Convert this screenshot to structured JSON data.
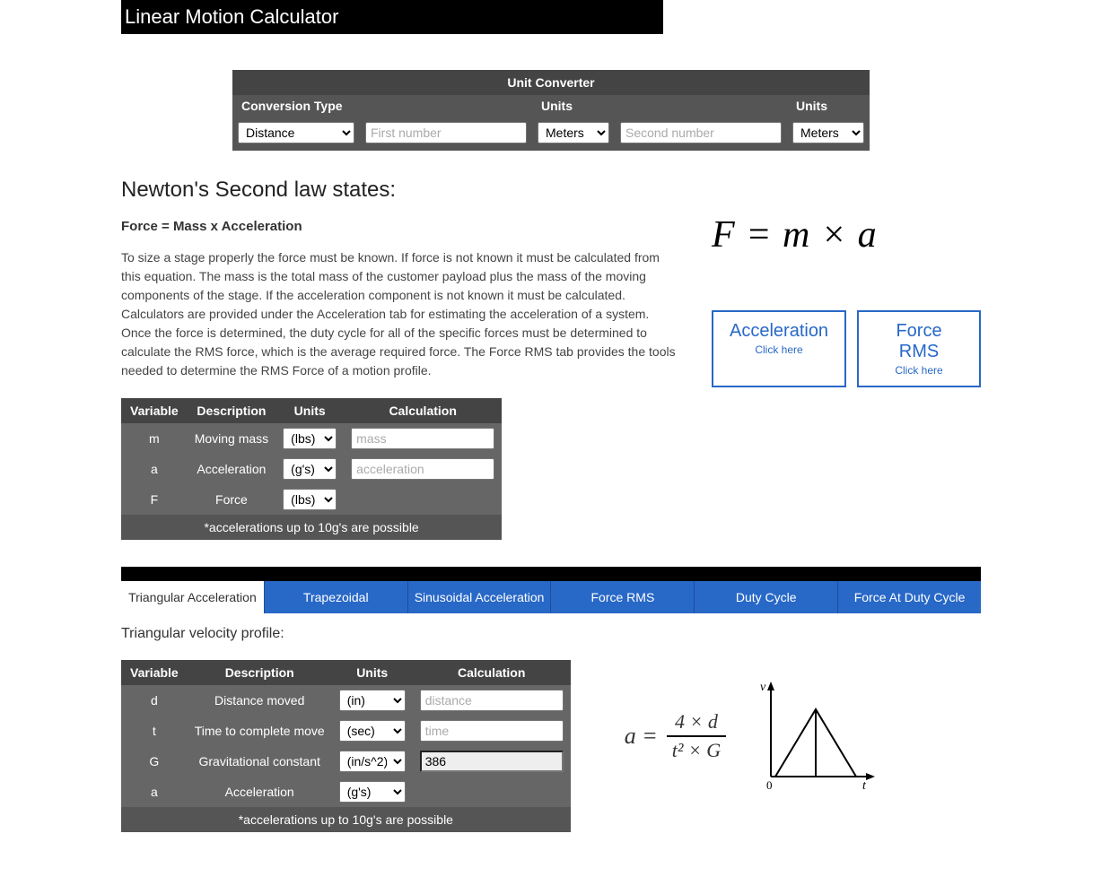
{
  "title": "Linear Motion Calculator",
  "converter": {
    "header": "Unit Converter",
    "col1": "Conversion Type",
    "col2": "Units",
    "col3": "Units",
    "type_selected": "Distance",
    "first_placeholder": "First number",
    "second_placeholder": "Second number",
    "unit1": "Meters",
    "unit2": "Meters"
  },
  "newton": {
    "heading": "Newton's Second law states:",
    "formula": "Force = Mass x Acceleration",
    "desc": "To size a stage properly the force must be known. If force is not known it must be calculated from this equation. The mass is the total mass of the customer payload plus the mass of the moving components of the stage. If the acceleration component is not known it must be calculated. Calculators are provided under the Acceleration tab for estimating the acceleration of a system. Once the force is determined, the duty cycle for all of the specific forces must be determined to calculate the RMS force, which is the average required force. The Force RMS tab provides the tools needed to determine the RMS Force of a motion profile.",
    "equation": "F = m × a",
    "btn1": {
      "title": "Acceleration",
      "sub": "Click here"
    },
    "btn2": {
      "title": "Force RMS",
      "sub": "Click here"
    }
  },
  "vars_top": {
    "headers": [
      "Variable",
      "Description",
      "Units",
      "Calculation"
    ],
    "rows": [
      {
        "v": "m",
        "d": "Moving mass",
        "u": "(lbs)",
        "calc_ph": "mass"
      },
      {
        "v": "a",
        "d": "Acceleration",
        "u": "(g's)",
        "calc_ph": "acceleration"
      },
      {
        "v": "F",
        "d": "Force",
        "u": "(lbs)",
        "calc_ph": null
      }
    ],
    "footer": "*accelerations up to 10g's are possible"
  },
  "tabs": [
    "Triangular Acceleration",
    "Trapezoidal",
    "Sinusoidal Acceleration",
    "Force RMS",
    "Duty Cycle",
    "Force At Duty Cycle"
  ],
  "tri": {
    "title": "Triangular velocity profile:",
    "equation_lhs": "a =",
    "equation_num": "4 × d",
    "equation_den": "t² × G",
    "graph": {
      "ylabel": "v",
      "xlabel": "t",
      "origin": "0"
    },
    "table": {
      "headers": [
        "Variable",
        "Description",
        "Units",
        "Calculation"
      ],
      "rows": [
        {
          "v": "d",
          "d": "Distance moved",
          "u": "(in)",
          "calc_ph": "distance",
          "ro": false
        },
        {
          "v": "t",
          "d": "Time to complete move",
          "u": "(sec)",
          "calc_ph": "time",
          "ro": false
        },
        {
          "v": "G",
          "d": "Gravitational constant",
          "u": "(in/s^2)",
          "calc_val": "386",
          "ro": true
        },
        {
          "v": "a",
          "d": "Acceleration",
          "u": "(g's)",
          "calc_ph": null,
          "ro": false
        }
      ],
      "footer": "*accelerations up to 10g's are possible"
    }
  }
}
